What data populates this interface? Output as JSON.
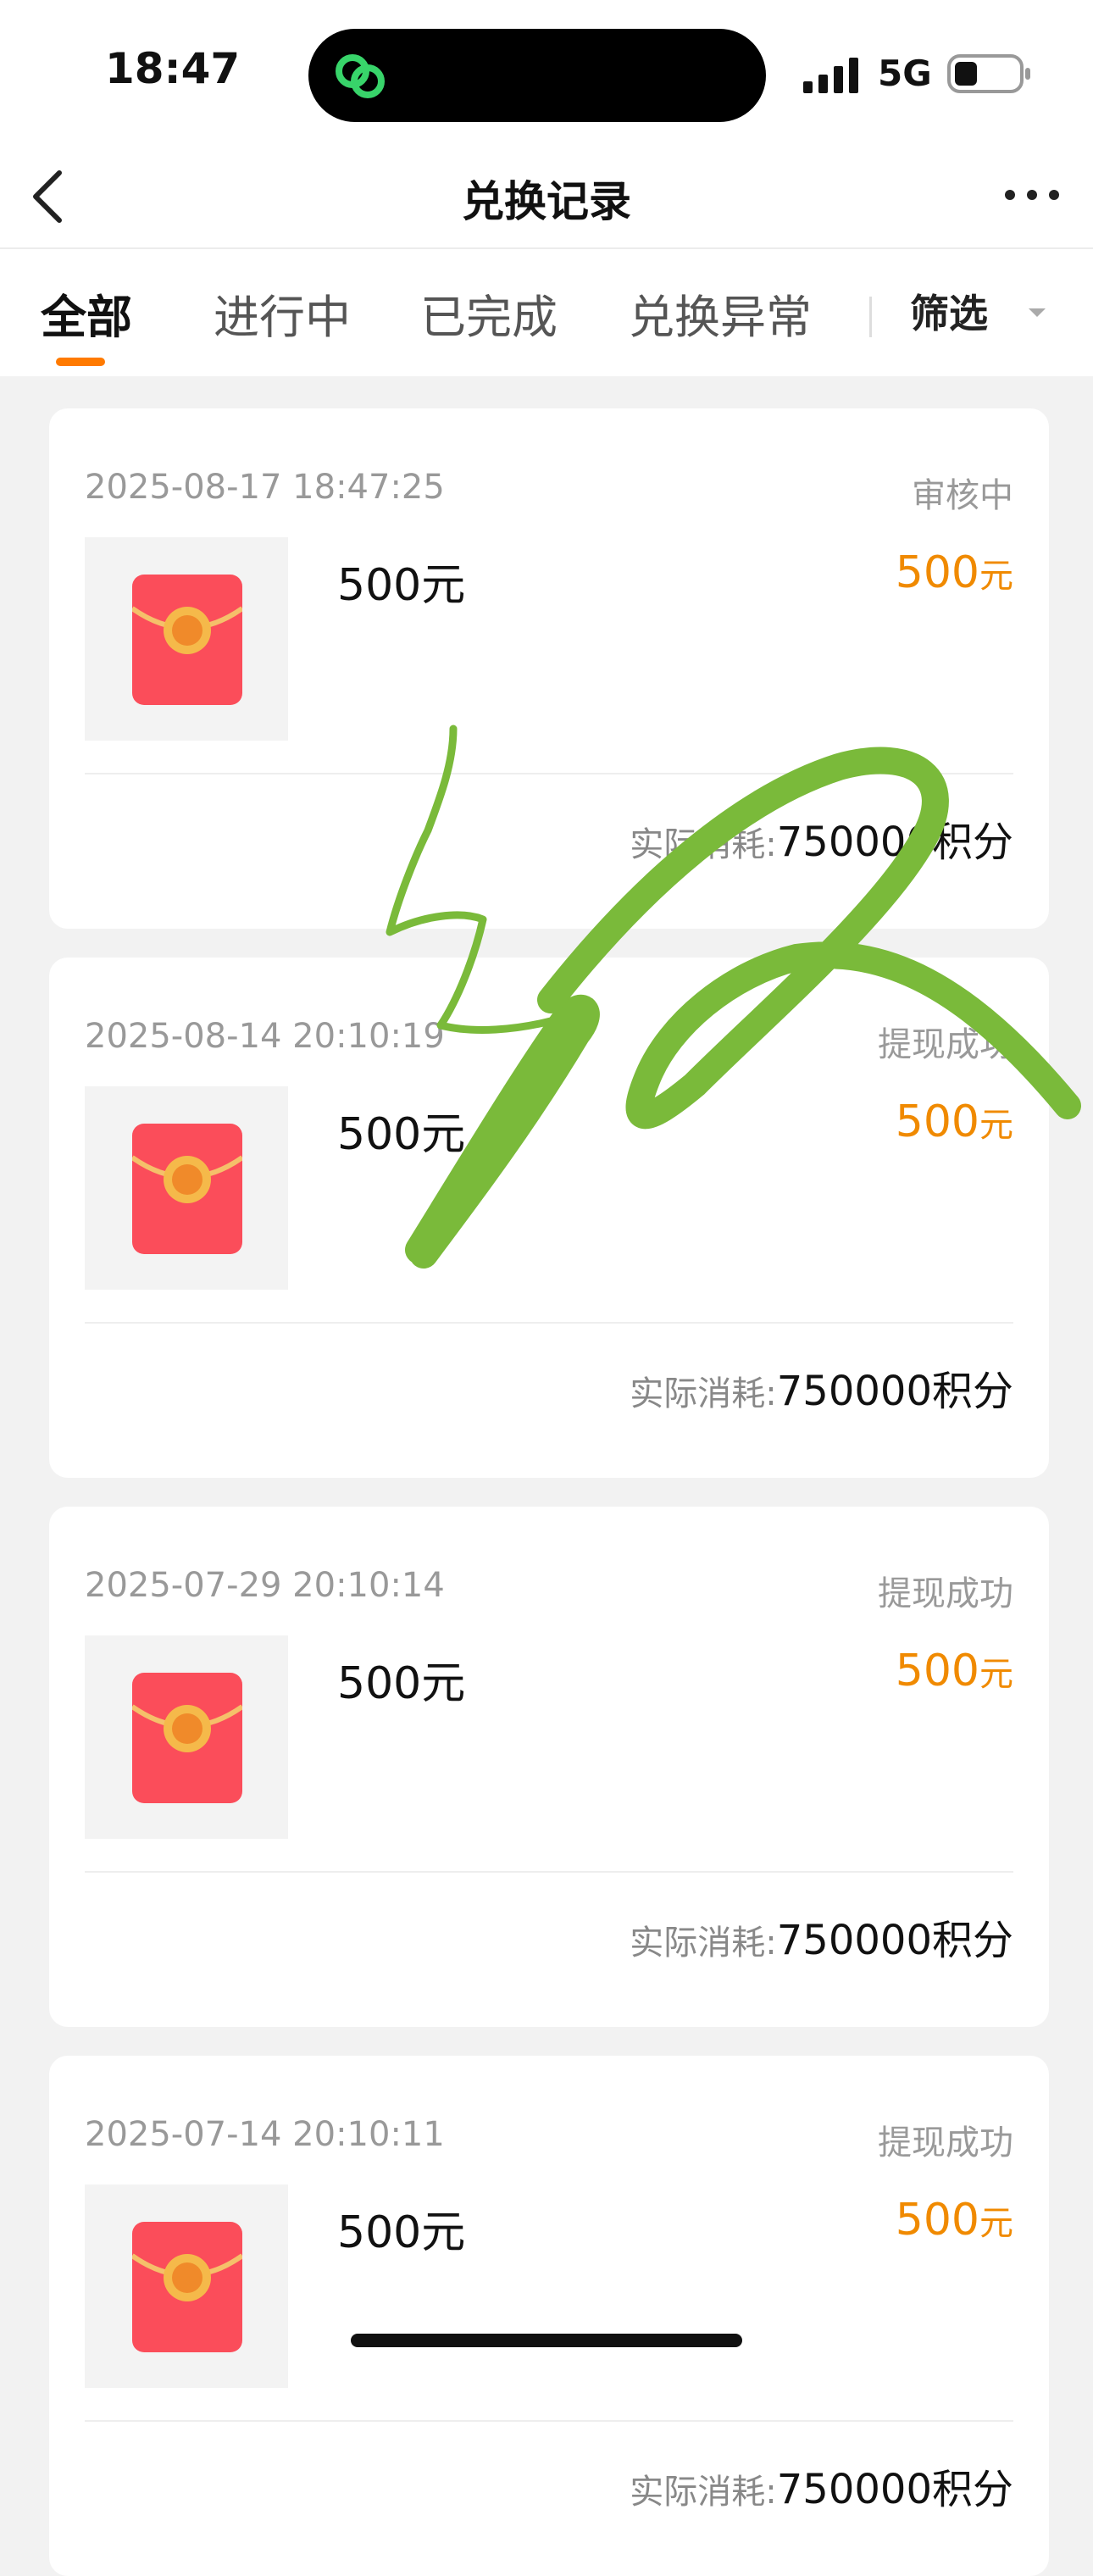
{
  "status_bar": {
    "time": "18:47",
    "network": "5G"
  },
  "header": {
    "title": "兑换记录"
  },
  "tabs": [
    {
      "label": "全部",
      "active": true
    },
    {
      "label": "进行中",
      "active": false
    },
    {
      "label": "已完成",
      "active": false
    },
    {
      "label": "兑换异常",
      "active": false
    }
  ],
  "filter": {
    "label": "筛选"
  },
  "records": [
    {
      "datetime": "2025-08-17 18:47:25",
      "status": "审核中",
      "item": "500元",
      "amount": "500",
      "unit": "元",
      "cost_label": "实际消耗:",
      "cost_value": "750000积分"
    },
    {
      "datetime": "2025-08-14 20:10:19",
      "status": "提现成功",
      "item": "500元",
      "amount": "500",
      "unit": "元",
      "cost_label": "实际消耗:",
      "cost_value": "750000积分"
    },
    {
      "datetime": "2025-07-29 20:10:14",
      "status": "提现成功",
      "item": "500元",
      "amount": "500",
      "unit": "元",
      "cost_label": "实际消耗:",
      "cost_value": "750000积分"
    },
    {
      "datetime": "2025-07-14 20:10:11",
      "status": "提现成功",
      "item": "500元",
      "amount": "500",
      "unit": "元",
      "cost_label": "实际消耗:",
      "cost_value": "750000积分"
    }
  ],
  "colors": {
    "accent": "#ff7a00",
    "amount": "#f08a00",
    "envelope": "#fb4d5a",
    "scribble": "#7aba3a"
  },
  "icons": {
    "back": "chevron-left-icon",
    "more": "more-dots-icon",
    "filter_caret": "caret-down-icon",
    "record_thumb": "red-envelope-icon"
  }
}
